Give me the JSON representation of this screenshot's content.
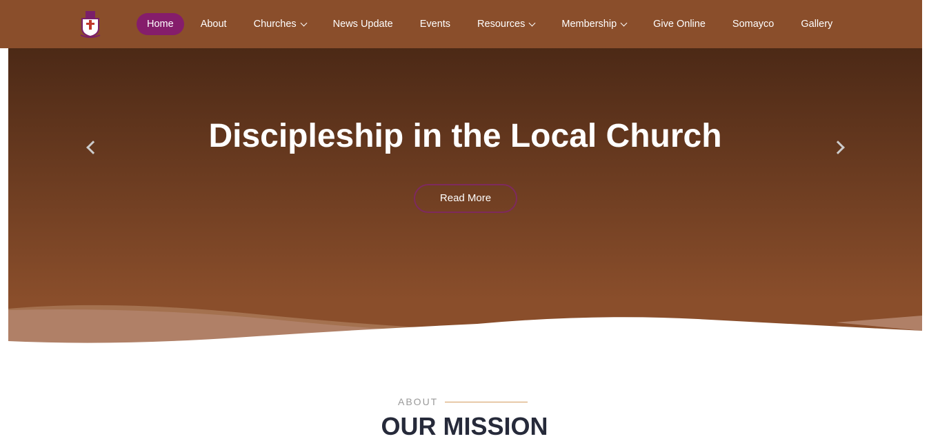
{
  "header": {
    "logo": "church-crest-logo",
    "nav": [
      {
        "label": "Home",
        "active": true
      },
      {
        "label": "About"
      },
      {
        "label": "Churches",
        "dropdown": true
      },
      {
        "label": "News Update"
      },
      {
        "label": "Events"
      },
      {
        "label": "Resources",
        "dropdown": true
      },
      {
        "label": "Membership",
        "dropdown": true
      },
      {
        "label": "Give Online"
      },
      {
        "label": "Somayco"
      },
      {
        "label": "Gallery"
      }
    ]
  },
  "hero": {
    "title": "Discipleship in the Local Church",
    "button": "Read More",
    "prev_icon": "chevron-left-icon",
    "next_icon": "chevron-right-icon"
  },
  "section": {
    "eyebrow": "ABOUT",
    "title": "OUR MISSION"
  },
  "colors": {
    "header": "#8a4e2b",
    "accent": "#851d6b",
    "divider": "#d39a5c"
  }
}
